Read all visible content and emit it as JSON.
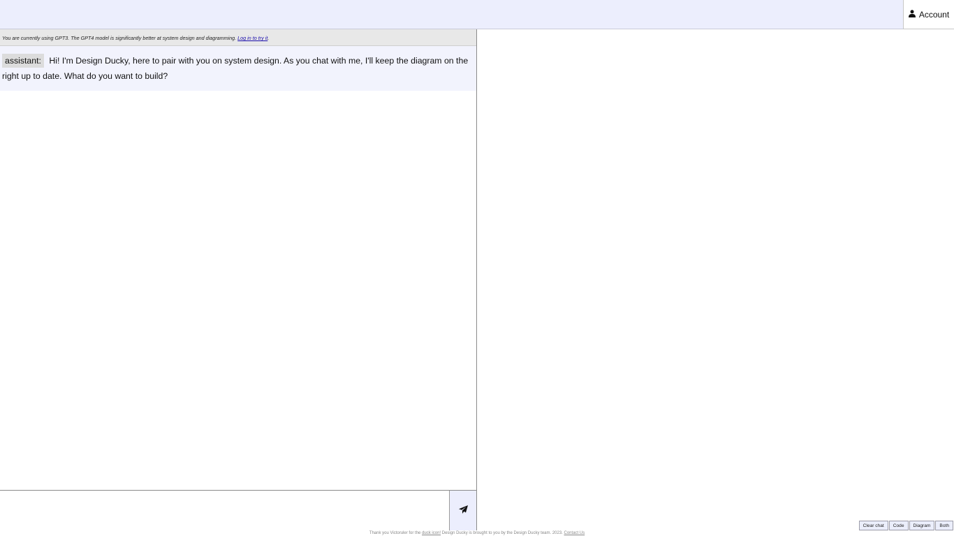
{
  "header": {
    "account_label": "Account",
    "account_icon": "user-icon"
  },
  "chat": {
    "notice": {
      "text": "You are currently using GPT3. The GPT4 model is significantly better at system design and diagramming. ",
      "link": "Log in to try it"
    },
    "messages": [
      {
        "role": "assistant:",
        "text": "Hi! I'm Design Ducky, here to pair with you on system design. As you chat with me, I'll keep the diagram on the right up to date. What do you want to build?"
      }
    ],
    "input": {
      "value": "",
      "placeholder": ""
    },
    "send_icon": "paper-plane-icon"
  },
  "view_controls": {
    "clear_chat": "Clear chat",
    "code": "Code",
    "diagram": "Diagram",
    "both": "Both"
  },
  "footer": {
    "prefix": "Thank you Victoruler for the ",
    "duck_link": "duck icon!",
    "middle": " Design Ducky is brought to you by the Design Ducky team. 2023. ",
    "contact_link": "Contact Us"
  },
  "colors": {
    "topbar_bg": "#eceefd",
    "message_bg": "#f2f3fd",
    "notice_bg": "#e8e8e8"
  }
}
